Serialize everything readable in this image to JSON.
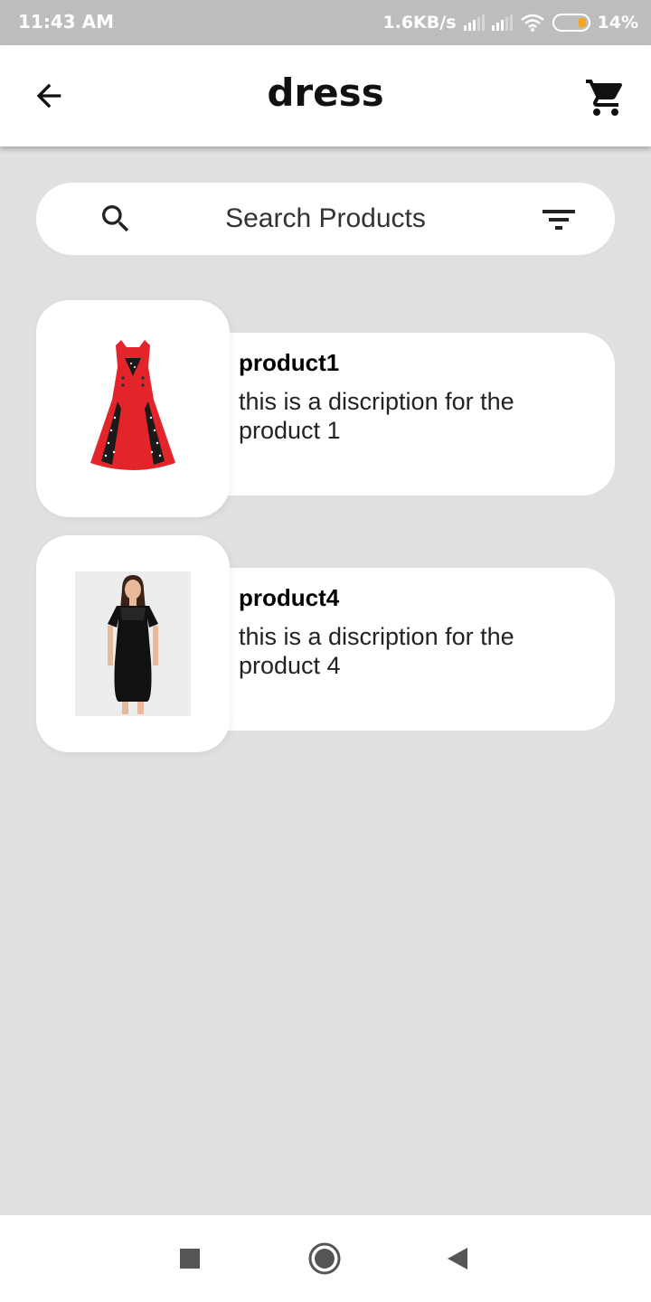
{
  "status_bar": {
    "time": "11:43 AM",
    "network_speed": "1.6KB/s",
    "battery_percent": "14%",
    "icons": [
      "signal-icon",
      "signal-icon",
      "wifi-icon",
      "battery-icon"
    ]
  },
  "app_bar": {
    "title": "dress",
    "back_icon": "arrow-left-icon",
    "cart_icon": "shopping-cart-icon"
  },
  "search": {
    "placeholder": "Search Products",
    "search_icon": "search-icon",
    "filter_icon": "filter-icon"
  },
  "products": [
    {
      "name": "product1",
      "description": "this is a discription for the product 1",
      "image": "red-dress-image"
    },
    {
      "name": "product4",
      "description": "this is a discription for the product 4",
      "image": "black-dress-image"
    }
  ],
  "colors": {
    "background": "#e0e0e0",
    "status_bar": "#bdbdbd",
    "card": "#ffffff",
    "red_dress": "#e3242b",
    "battery_low": "#f5a623"
  },
  "nav_bar": {
    "icons": [
      "recent-apps-icon",
      "home-icon",
      "back-triangle-icon"
    ]
  }
}
